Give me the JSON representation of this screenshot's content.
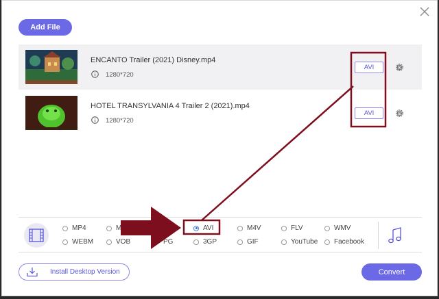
{
  "toolbar": {
    "add_file_label": "Add File"
  },
  "files": [
    {
      "name": "ENCANTO Trailer (2021) Disney.mp4",
      "resolution": "1280*720",
      "format": "AVI"
    },
    {
      "name": "HOTEL TRANSYLVANIA 4 Trailer 2 (2021).mp4",
      "resolution": "1280*720",
      "format": "AVI"
    }
  ],
  "formats": {
    "selected": "AVI",
    "row1": [
      "MP4",
      "M",
      "AVI",
      "M4V",
      "FLV",
      "WMV"
    ],
    "row2": [
      "WEBM",
      "VOB",
      "PG",
      "3GP",
      "GIF",
      "YouTube",
      "Facebook"
    ]
  },
  "footer": {
    "install_label": "Install Desktop Version",
    "convert_label": "Convert"
  },
  "colors": {
    "accent": "#6c69e6",
    "annotation": "#7d0e1e"
  },
  "icons": [
    "close-icon",
    "info-icon",
    "gear-icon",
    "video-film-icon",
    "music-note-icon",
    "download-icon"
  ]
}
